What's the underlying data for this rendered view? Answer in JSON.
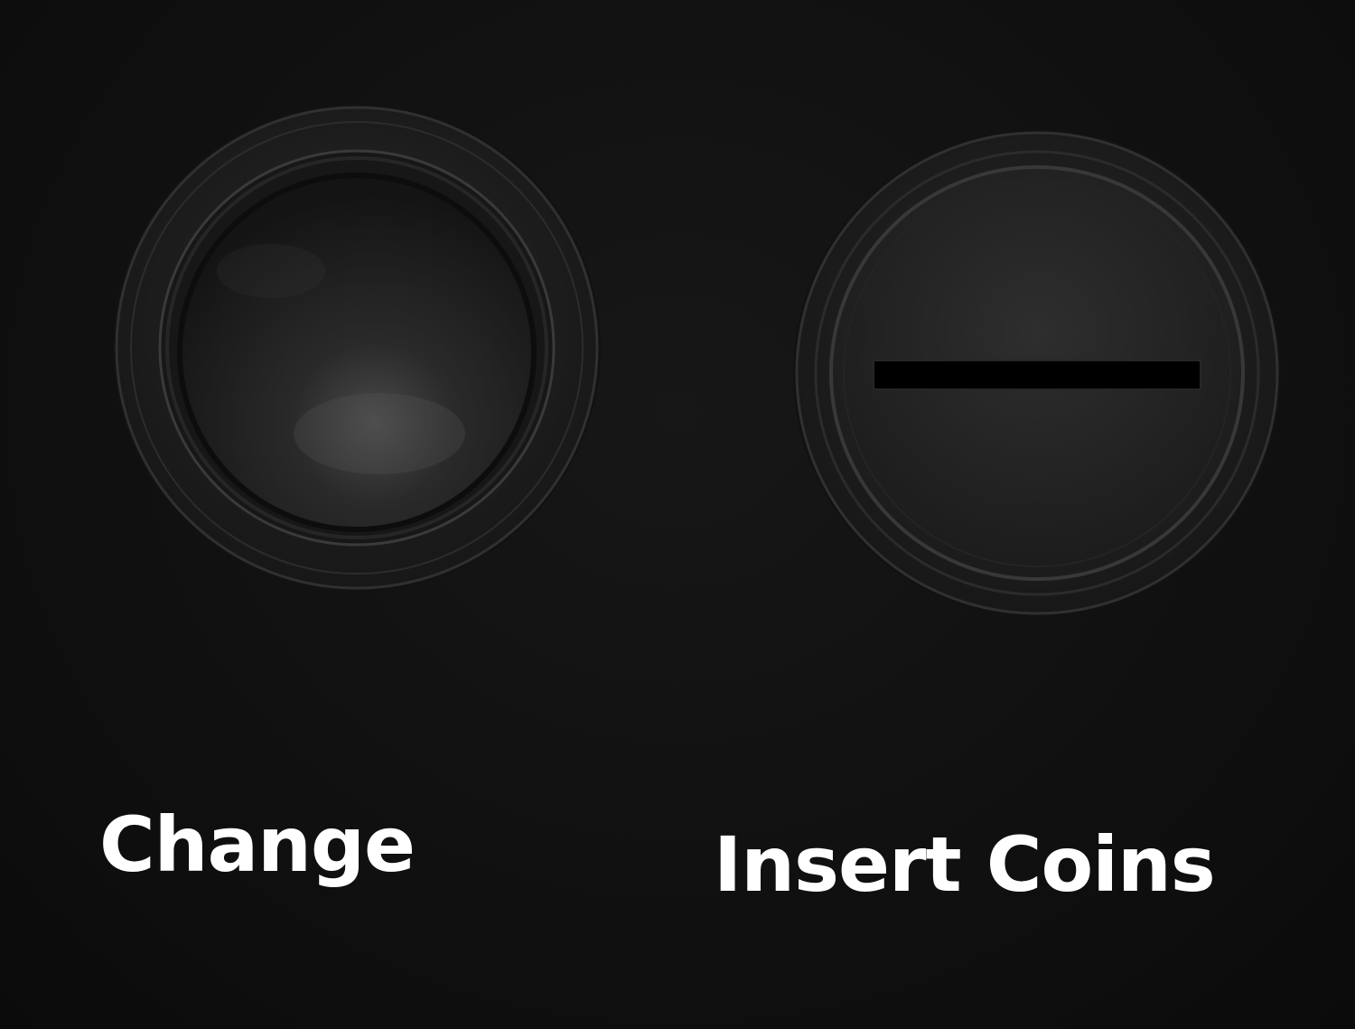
{
  "labels": {
    "change": "Change",
    "insert_coins": "Insert Coins"
  },
  "controls": {
    "change_button_icon": "round-push-button",
    "coin_slot_icon": "coin-slot"
  },
  "colors": {
    "panel": "#101010",
    "label_text": "#ffffff",
    "button_plastic": "#1c1c1c",
    "slot": "#000000"
  }
}
